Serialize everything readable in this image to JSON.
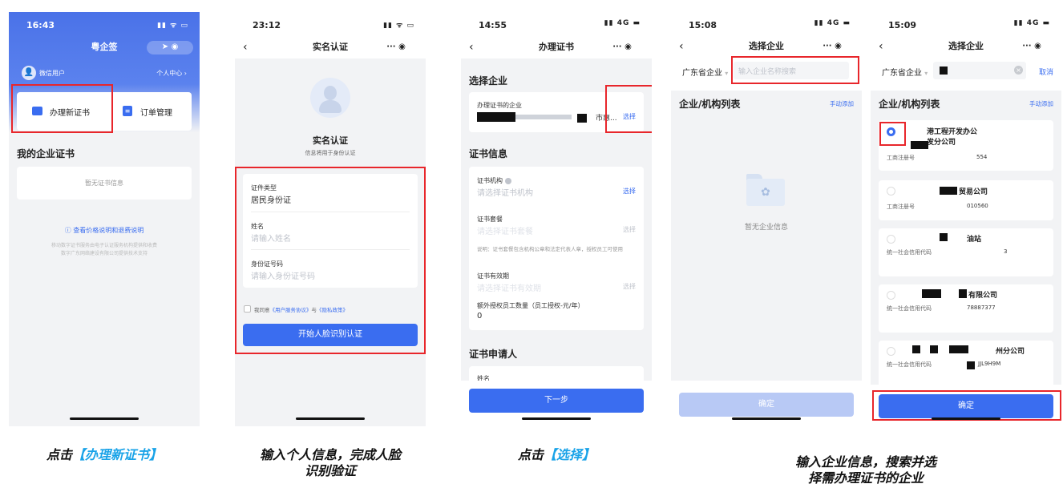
{
  "p1": {
    "time": "16:43",
    "status_icons": "▮▮ ᯤ ▭",
    "title": "粤企签",
    "user": "微信用户",
    "user_center": "个人中心 ›",
    "menu_new_cert": "办理新证书",
    "menu_orders": "订单管理",
    "section_title": "我的企业证书",
    "empty": "暂无证书信息",
    "price_link": "查看价格说明和退费说明",
    "footer1": "移动数字证书服务由电子认证服务机构提供和收费",
    "footer2": "数字广东网络建设有限公司提供技术支持"
  },
  "p2": {
    "time": "23:12",
    "title": "实名认证",
    "heading": "实名认证",
    "sub": "信息将用于身份认证",
    "cert_type_label": "证件类型",
    "cert_type_value": "居民身份证",
    "name_label": "姓名",
    "name_placeholder": "请输入姓名",
    "id_label": "身份证号码",
    "id_placeholder": "请输入身份证号码",
    "agree_prefix": "我同意",
    "agree_link1": "《用户服务协议》",
    "agree_and": "与",
    "agree_link2": "《隐私政策》",
    "button": "开始人脸识别认证"
  },
  "p3": {
    "time": "14:55",
    "title": "办理证书",
    "sec_company": "选择企业",
    "company_label": "办理证书的企业",
    "company_value": "市惠...",
    "select": "选择",
    "sec_cert": "证书信息",
    "org_label": "证书机构",
    "org_placeholder": "请选择证书机构",
    "plan_label": "证书套餐",
    "plan_placeholder": "请选择证书套餐",
    "note": "说明：证书套餐包含机构公章和法定代表人章，授权员工可使用",
    "valid_label": "证书有效期",
    "valid_placeholder": "请选择证书有效期",
    "extra_label": "额外授权员工数量（员工授权-元/年）",
    "extra_value": "0",
    "sec_applicant": "证书申请人",
    "applicant_name": "姓名",
    "next": "下一步"
  },
  "p4": {
    "time": "15:08",
    "title": "选择企业",
    "region": "广东省企业",
    "search_placeholder": "输入企业名称搜索",
    "list_title": "企业/机构列表",
    "manual_add": "手动添加",
    "empty": "暂无企业信息",
    "confirm": "确定"
  },
  "p5": {
    "time": "15:09",
    "title": "选择企业",
    "region": "广东省企业",
    "cancel": "取消",
    "list_title": "企业/机构列表",
    "manual_add": "手动添加",
    "items": [
      {
        "name_a": "港工程开发办公",
        "name_b": "发分公司",
        "label": "工商注册号",
        "value": "554"
      },
      {
        "name_a": "贸易公司",
        "name_b": "",
        "label": "工商注册号",
        "value": "010560"
      },
      {
        "name_a": "油站",
        "name_b": "",
        "label": "统一社会信用代码",
        "value": "3"
      },
      {
        "name_a": "有限公司",
        "name_b": "",
        "label": "统一社会信用代码",
        "value": "78887377"
      },
      {
        "name_a": "州分公司",
        "name_b": "",
        "label": "统一社会信用代码",
        "value": "JJL9H9M"
      }
    ],
    "confirm": "确定"
  },
  "captions": {
    "c1_pre": "点击",
    "c1_hl": "【办理新证书】",
    "c2_l1": "输入个人信息，完成人脸",
    "c2_l2": "识别验证",
    "c3_pre": "点击",
    "c3_hl": "【选择】",
    "c4_l1": "输入企业信息，搜索并选",
    "c4_l2": "择需办理证书的企业"
  },
  "colors": {
    "primary": "#3a6df0",
    "highlight_box": "#e8262b",
    "caption_highlight": "#1aa3e8"
  }
}
